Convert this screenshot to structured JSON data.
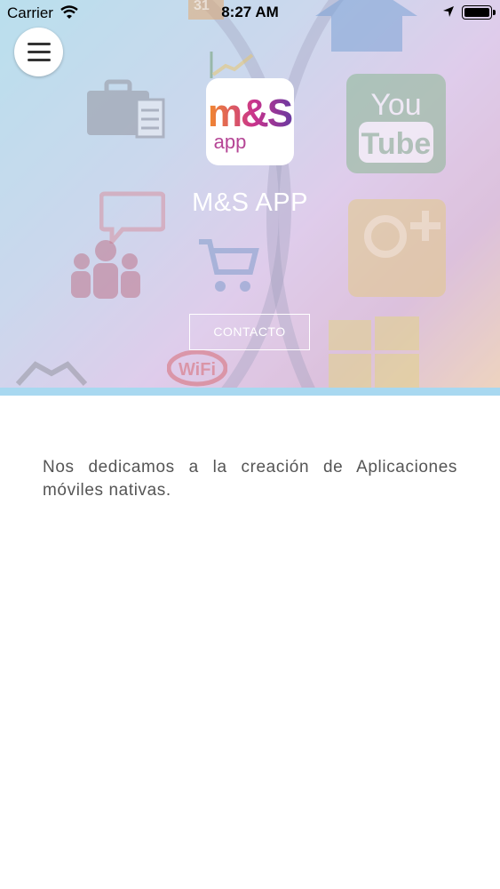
{
  "status_bar": {
    "carrier": "Carrier",
    "time": "8:27 AM"
  },
  "header": {
    "app_name": "M&S APP",
    "contact_button": "CONTACTO",
    "logo": {
      "line1": "m&S",
      "line2": "app"
    }
  },
  "background_icons": {
    "calendar_number": "31",
    "youtube_you": "You",
    "youtube_tube": "Tube",
    "wifi_text": "WiFi"
  },
  "content": {
    "description": "Nos dedicamos a la creación de Aplicaciones móviles nativas."
  },
  "colors": {
    "accent_stripe": "#a8d8f0",
    "logo_orange": "#f28a2e",
    "logo_magenta": "#c9338d",
    "logo_purple": "#6a3aa0",
    "text_body": "#555555"
  }
}
